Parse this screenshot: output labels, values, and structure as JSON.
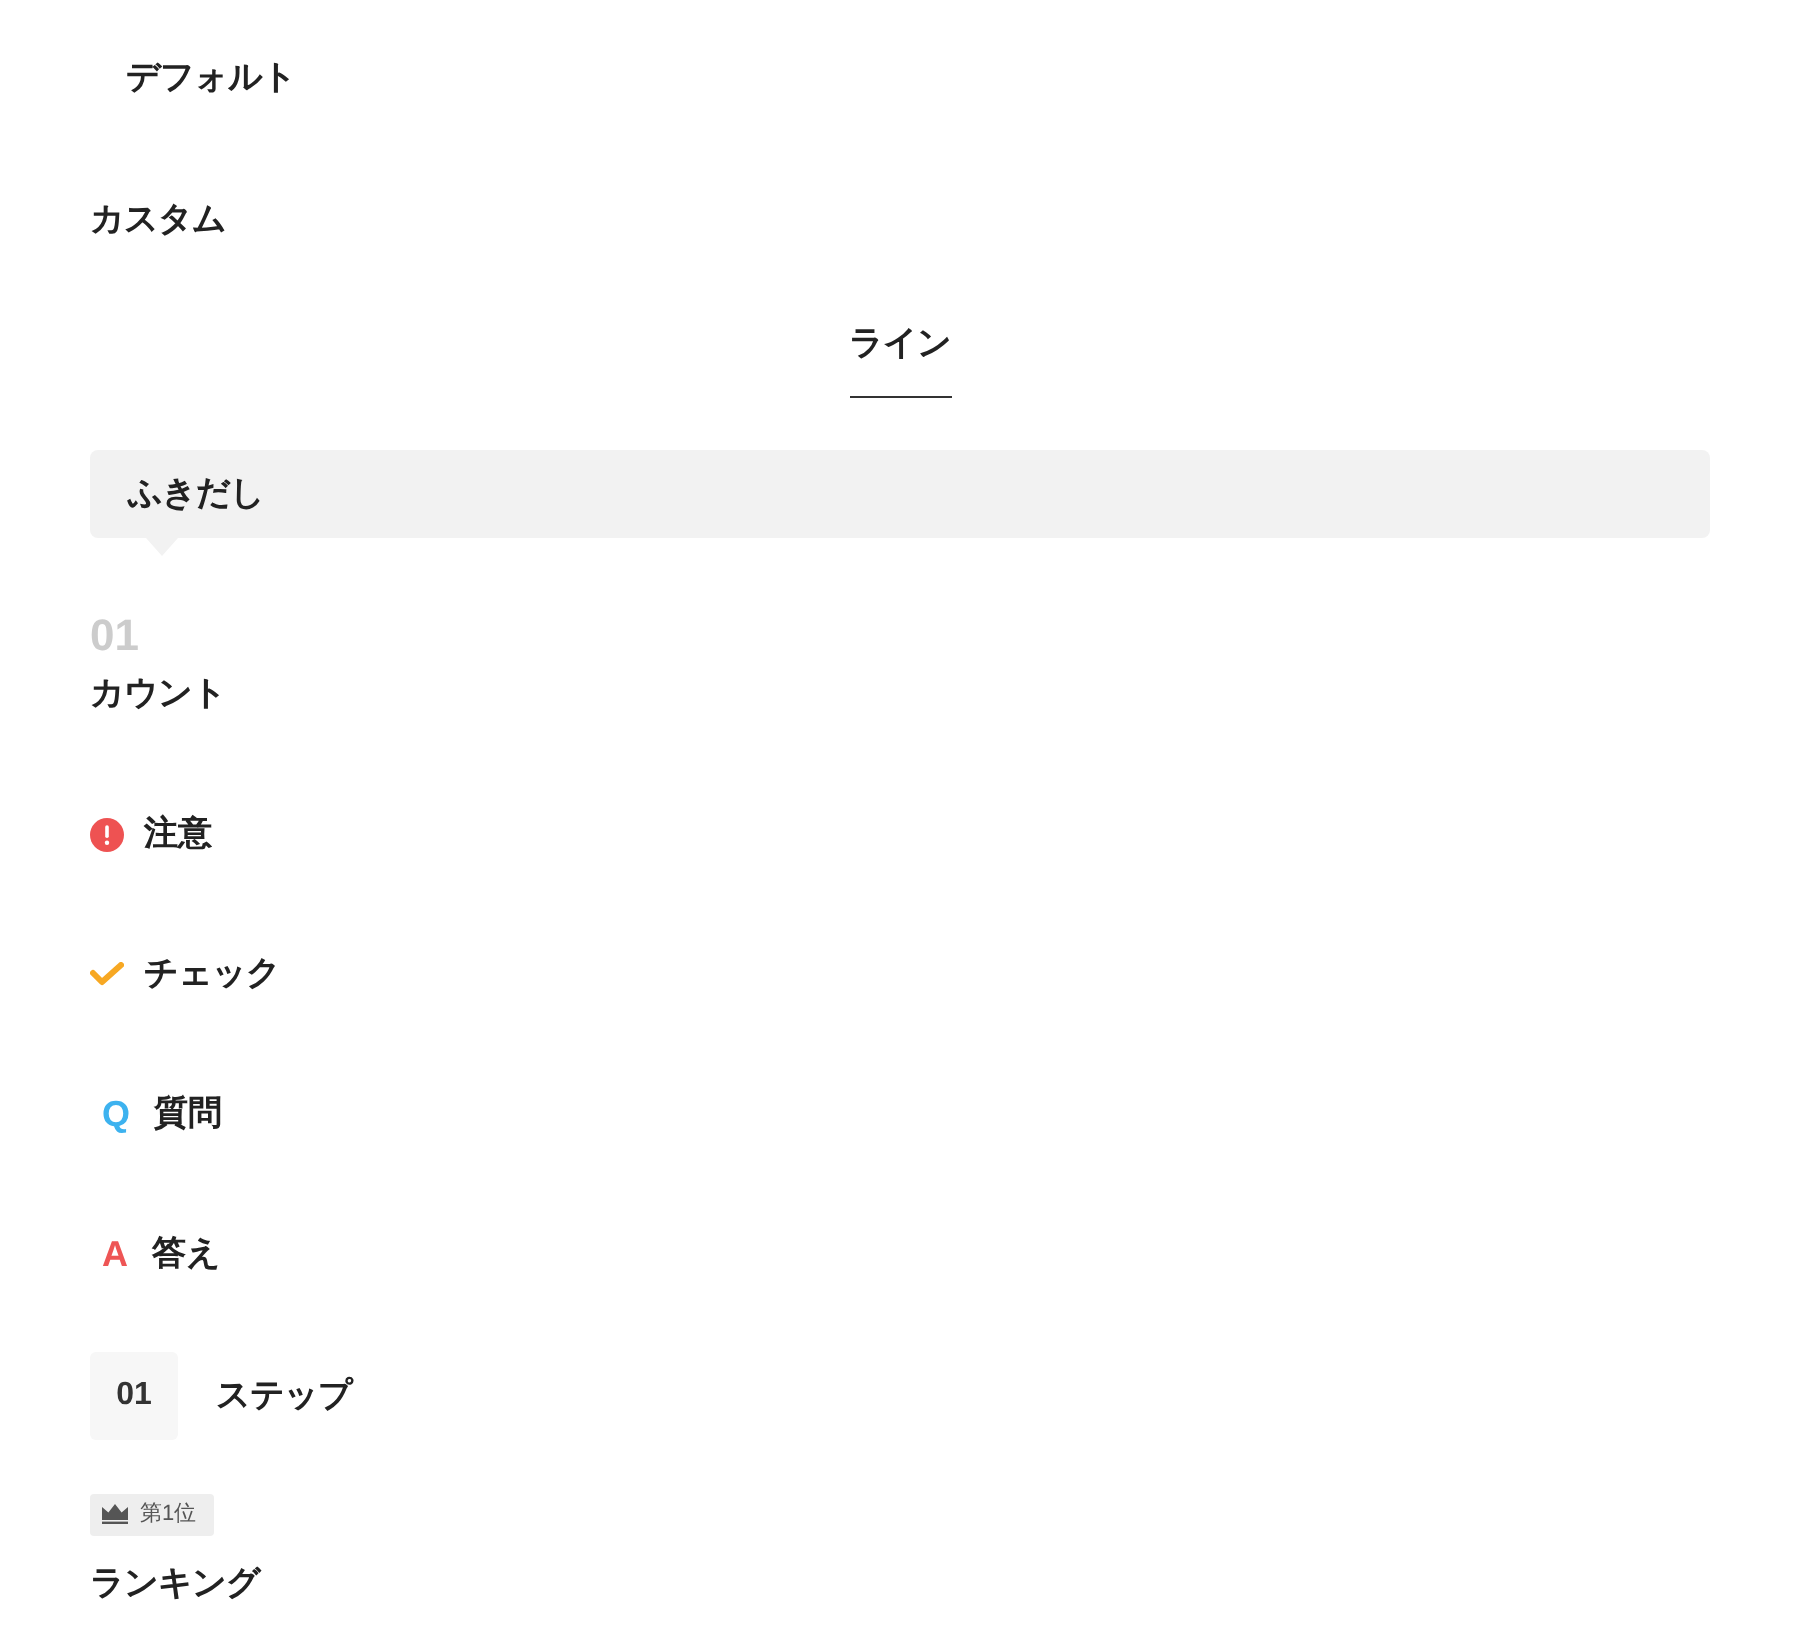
{
  "headings": [
    {
      "kind": "default",
      "label": "デフォルト"
    },
    {
      "kind": "custom",
      "label": "カスタム"
    },
    {
      "kind": "line",
      "label": "ライン"
    },
    {
      "kind": "balloon",
      "label": "ふきだし"
    },
    {
      "kind": "count",
      "number": "01",
      "label": "カウント"
    },
    {
      "kind": "caution",
      "label": "注意"
    },
    {
      "kind": "check",
      "label": "チェック"
    },
    {
      "kind": "question",
      "mark": "Q",
      "label": "質問"
    },
    {
      "kind": "answer",
      "mark": "A",
      "label": "答え"
    },
    {
      "kind": "step",
      "number": "01",
      "label": "ステップ"
    },
    {
      "kind": "ranking",
      "badge": "第1位",
      "label": "ランキング"
    }
  ]
}
